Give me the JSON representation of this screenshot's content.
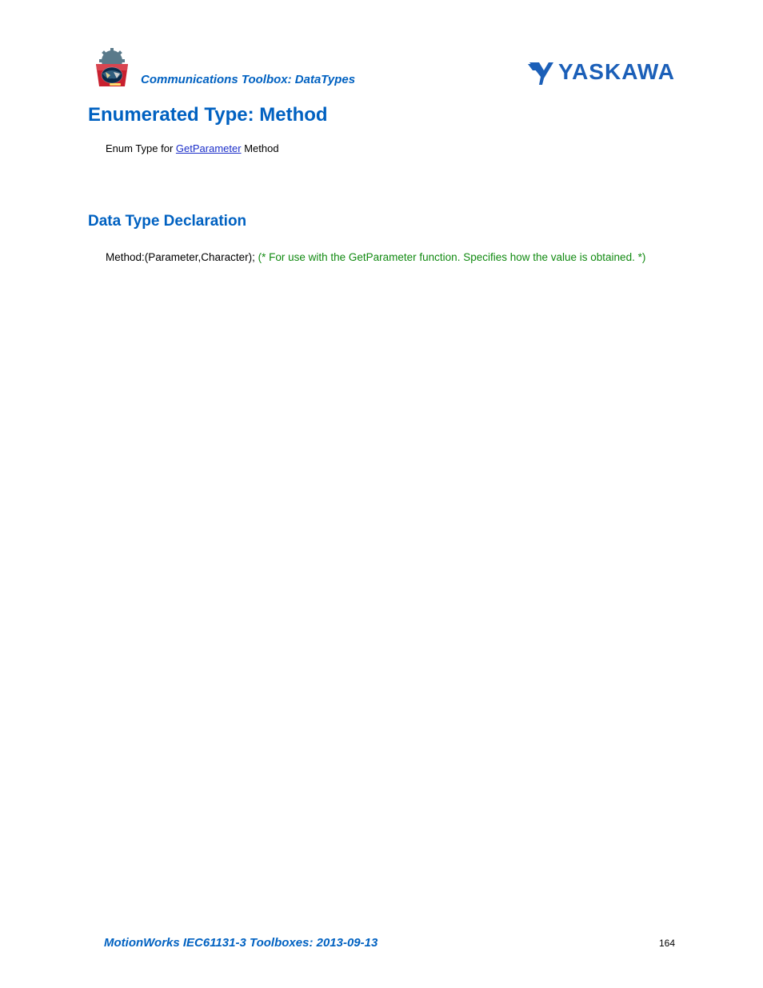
{
  "header": {
    "breadcrumb": "Communications Toolbox: DataTypes",
    "brand_text": "YASKAWA"
  },
  "title": "Enumerated Type: Method",
  "intro": {
    "prefix": "Enum Type for ",
    "link_text": "GetParameter",
    "suffix": " Method"
  },
  "section": {
    "heading": "Data Type Declaration",
    "declaration_code": "Method:(Parameter,Character); ",
    "declaration_comment": "(*   For use with the GetParameter function.  Specifies how the value is obtained.  *)"
  },
  "footer": {
    "title": "MotionWorks IEC61131-3 Toolboxes: 2013-09-13",
    "page_number": "164"
  }
}
